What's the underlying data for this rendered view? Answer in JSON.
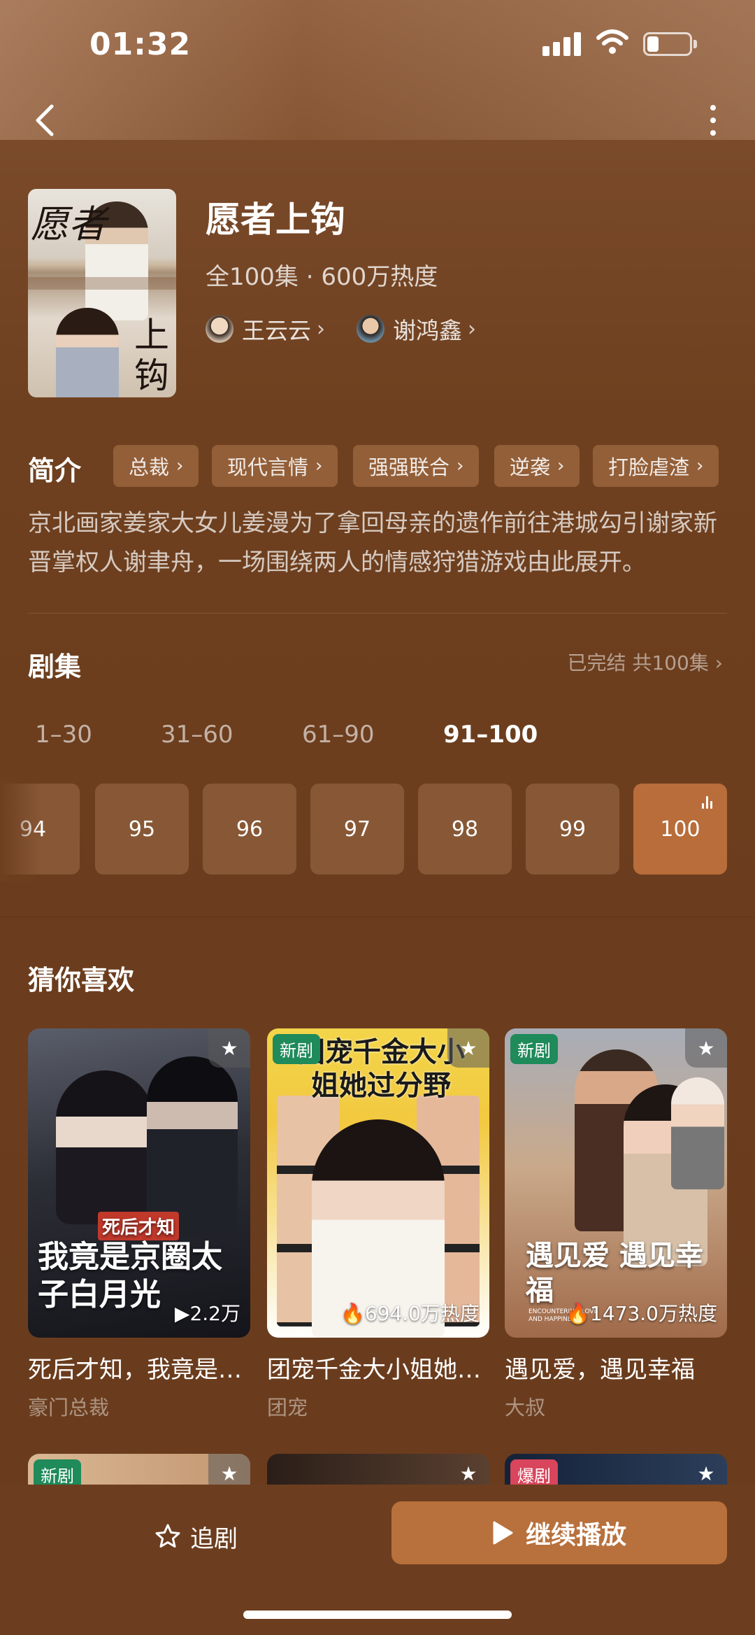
{
  "status_bar": {
    "time": "01:32",
    "battery_level": 0.2
  },
  "drama": {
    "title": "愿者上钩",
    "meta": "全100集 · 600万热度",
    "poster_text_1": "愿者",
    "poster_text_2": "上钩",
    "actors": [
      {
        "name": "王云云"
      },
      {
        "name": "谢鸿鑫"
      }
    ]
  },
  "synopsis": {
    "label": "简介",
    "tags": [
      "总裁",
      "现代言情",
      "强强联合",
      "逆袭",
      "打脸虐渣"
    ],
    "text": "京北画家姜家大女儿姜漫为了拿回母亲的遗作前往港城勾引谢家新晋掌权人谢聿舟，一场围绕两人的情感狩猎游戏由此展开。"
  },
  "episodes": {
    "label": "剧集",
    "status": "已完结 共100集",
    "ranges": [
      "1–30",
      "31–60",
      "61–90",
      "91–100"
    ],
    "active_range": "91–100",
    "items": [
      "94",
      "95",
      "96",
      "97",
      "98",
      "99",
      "100"
    ],
    "current": "100"
  },
  "recommend": {
    "label": "猜你喜欢",
    "cards": [
      {
        "title": "死后才知，我竟是…",
        "genre": "豪门总裁",
        "stat": "▶2.2万",
        "badge": "",
        "cover_text": "我竟是京圈太子白月光",
        "cover_subtext": "死后才知"
      },
      {
        "title": "团宠千金大小姐她…",
        "genre": "团宠",
        "stat": "694.0万热度",
        "badge": "新剧",
        "cover_text": "团宠千金大小姐她过分野",
        "cover_subtext": ""
      },
      {
        "title": "遇见爱，遇见幸福",
        "genre": "大叔",
        "stat": "1473.0万热度",
        "badge": "新剧",
        "cover_text": "遇见爱 遇见幸福",
        "cover_subtext": "ENCOUNTERING LOVE AND HAPPINESS"
      }
    ],
    "row2_badges": [
      "新剧",
      "",
      "爆剧"
    ]
  },
  "bottom": {
    "follow_label": "追剧",
    "play_label": "继续播放"
  },
  "colors": {
    "accent": "#b8703c",
    "tag_bg": "#a06941",
    "badge_new": "#1f8a5a",
    "badge_hot": "#d8455c"
  },
  "icons": [
    "back-icon",
    "more-icon",
    "chevron-right-icon",
    "star-icon",
    "play-icon",
    "signal-icon",
    "wifi-icon",
    "battery-icon",
    "playing-bars-icon"
  ]
}
